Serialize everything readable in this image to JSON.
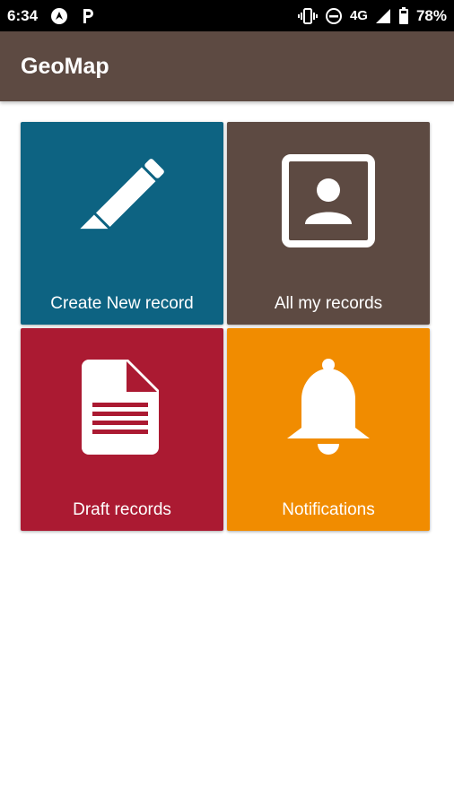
{
  "status_bar": {
    "time": "6:34",
    "network": "4G",
    "battery": "78%",
    "icons": [
      "navigation-icon",
      "parking-icon",
      "vibrate-icon",
      "do-not-disturb-icon",
      "signal-icon",
      "battery-icon"
    ]
  },
  "app_bar": {
    "title": "GeoMap"
  },
  "tiles": [
    {
      "label": "Create New record",
      "icon": "pencil-icon",
      "color": "#0d6382"
    },
    {
      "label": "All my records",
      "icon": "account-box-icon",
      "color": "#5d4a42"
    },
    {
      "label": "Draft records",
      "icon": "document-icon",
      "color": "#ab1a32"
    },
    {
      "label": "Notifications",
      "icon": "bell-icon",
      "color": "#f18c00"
    }
  ]
}
